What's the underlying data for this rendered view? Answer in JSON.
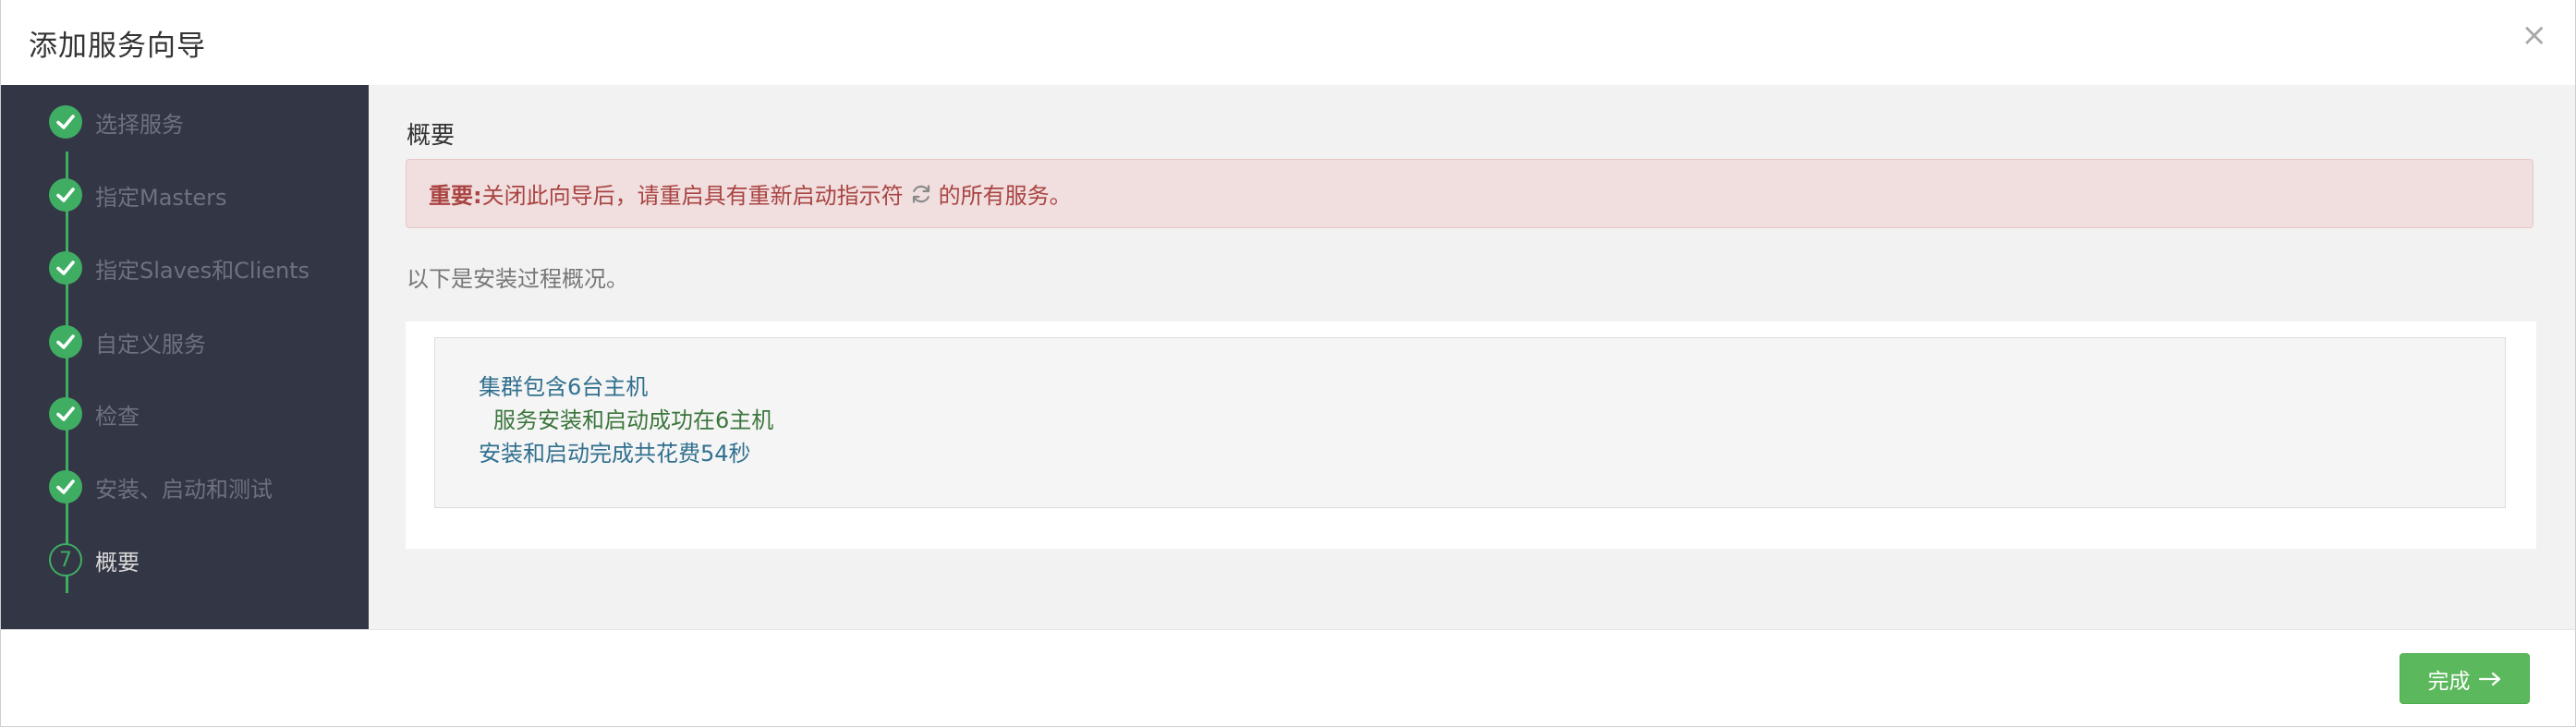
{
  "modal": {
    "title": "添加服务向导",
    "close_label": "×"
  },
  "wizard_steps": [
    {
      "label": "选择服务",
      "status": "completed"
    },
    {
      "label": "指定Masters",
      "status": "completed"
    },
    {
      "label": "指定Slaves和Clients",
      "status": "completed"
    },
    {
      "label": "自定义服务",
      "status": "completed"
    },
    {
      "label": "检查",
      "status": "completed"
    },
    {
      "label": "安装、启动和测试",
      "status": "completed"
    },
    {
      "label": "概要",
      "status": "current",
      "number": "7"
    }
  ],
  "content": {
    "title": "概要",
    "alert": {
      "strong": "重要:",
      "text_before_icon": "关闭此向导后，请重启具有重新启动指示符",
      "icon": "refresh-icon",
      "text_after_icon": "的所有服务。"
    },
    "overview_text": "以下是安装过程概况。",
    "summary_lines": [
      "集群包含6台主机",
      "服务安装和启动成功在6主机",
      "安装和启动完成共花费54秒"
    ]
  },
  "footer": {
    "done_label": "完成",
    "done_icon": "arrow-right-icon"
  },
  "colors": {
    "sidebar_bg": "#333645",
    "step_complete": "#3fae63",
    "alert_text": "#a94442",
    "alert_bg": "#f1dede",
    "info_text": "#31708f",
    "success_text": "#3c763d",
    "done_button": "#5cb85c"
  }
}
